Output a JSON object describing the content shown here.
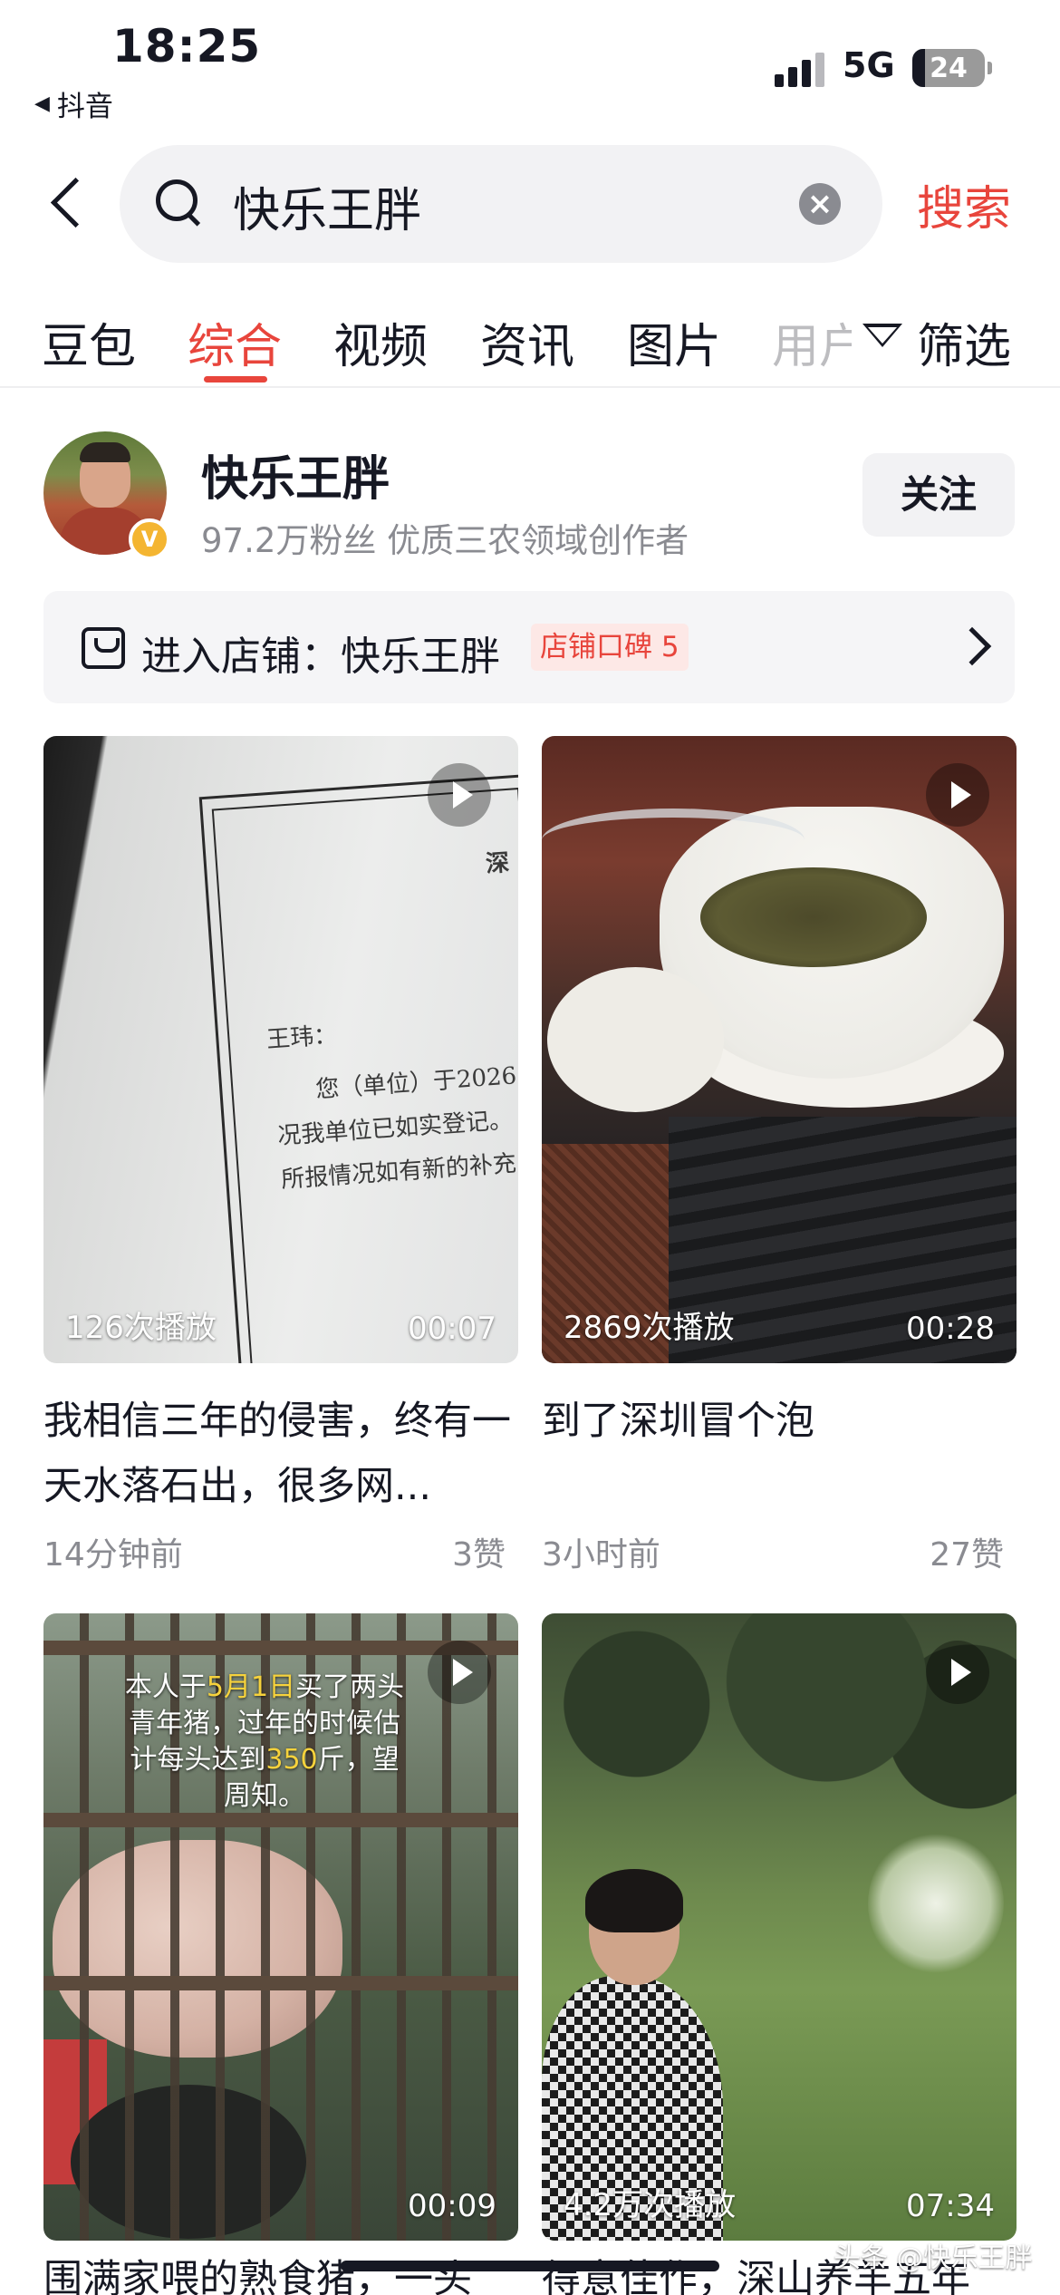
{
  "status_bar": {
    "time": "18:25",
    "back_app": "抖音",
    "network": "5G",
    "battery": "24"
  },
  "search": {
    "query": "快乐王胖",
    "button": "搜索"
  },
  "tabs": [
    {
      "label": "豆包",
      "active": false
    },
    {
      "label": "综合",
      "active": true
    },
    {
      "label": "视频",
      "active": false
    },
    {
      "label": "资讯",
      "active": false
    },
    {
      "label": "图片",
      "active": false
    },
    {
      "label": "用户",
      "active": false
    }
  ],
  "filter_label": "筛选",
  "profile": {
    "name": "快乐王胖",
    "subtitle": "97.2万粉丝 优质三农领域创作者",
    "verified_mark": "V",
    "follow_label": "关注"
  },
  "shop": {
    "label": "进入店铺：快乐王胖",
    "badge": "店铺口碑 5"
  },
  "videos": [
    {
      "views": "126次播放",
      "duration": "00:07",
      "title": "我相信三年的侵害，终有一天水落石出，很多网...",
      "time_ago": "14分钟前",
      "likes": "3赞",
      "thumb_lines": [
        "深",
        "王玮：",
        "您（单位）于2026",
        "况我单位已如实登记。",
        "所报情况如有新的补充"
      ]
    },
    {
      "views": "2869次播放",
      "duration": "00:28",
      "title": "到了深圳冒个泡",
      "time_ago": "3小时前",
      "likes": "27赞"
    },
    {
      "duration": "00:09",
      "overlay_text": {
        "part1": "本人于",
        "highlight1": "5月1日",
        "part2": "买了两头青年猪，过年的时候估计每头达到",
        "highlight2": "350",
        "part3": "斤，望周知。"
      },
      "peek_title": "围满家喂的熟食猪，一头"
    },
    {
      "views": "4.2万次播放",
      "duration": "07:34",
      "peek_title": "得意佳作，深山养羊五年"
    }
  ],
  "watermark": "头条 @快乐王胖"
}
